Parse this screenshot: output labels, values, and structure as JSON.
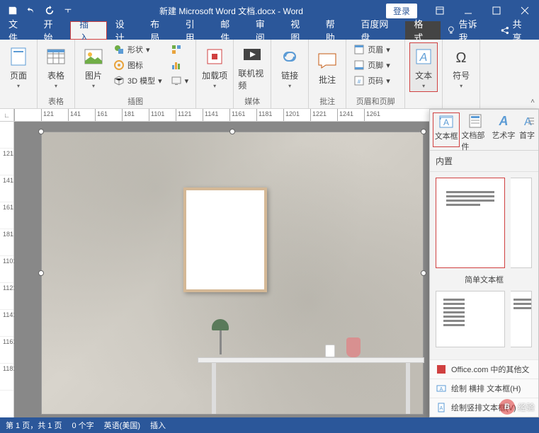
{
  "titlebar": {
    "doc_title": "新建 Microsoft Word 文档.docx - Word",
    "login": "登录"
  },
  "tabs": {
    "file": "文件",
    "home": "开始",
    "insert": "插入",
    "design": "设计",
    "layout": "布局",
    "references": "引用",
    "mailings": "邮件",
    "review": "审阅",
    "view": "视图",
    "help": "帮助",
    "baidu": "百度网盘",
    "format": "格式",
    "tellme": "告诉我",
    "share": "共享"
  },
  "ribbon": {
    "page": "页面",
    "table": "表格",
    "pictures": "图片",
    "shapes": "形状",
    "icons": "图标",
    "model3d": "3D 模型",
    "addins": "加载项",
    "video": "联机视频",
    "links": "链接",
    "comment": "批注",
    "header": "页眉",
    "footer": "页脚",
    "pagenum": "页码",
    "text": "文本",
    "symbols": "符号",
    "grp_table": "表格",
    "grp_illust": "插图",
    "grp_media": "媒体",
    "grp_comment": "批注",
    "grp_hf": "页眉和页脚"
  },
  "dropdown": {
    "textbox": "文本框",
    "parts": "文档部件",
    "wordart": "艺术字",
    "dropcap": "首字",
    "builtin": "内置",
    "thumb1_label": "简单文本框",
    "more_office": "Office.com 中的其他文",
    "draw_h": "绘制 横排 文本框(H)",
    "draw_v": "绘制竖排文本框(V)"
  },
  "ruler": {
    "marks": [
      "",
      "121",
      "141",
      "161",
      "181",
      "1101",
      "1121",
      "1141",
      "1161",
      "1181",
      "1201",
      "1221",
      "1241",
      "1261"
    ]
  },
  "ruler_v": {
    "marks": [
      "",
      "121",
      "141",
      "161",
      "181",
      "1101",
      "1121",
      "1141",
      "1161",
      "1181"
    ]
  },
  "status": {
    "page": "第 1 页，共 1 页",
    "words": "0 个字",
    "lang": "英语(美国)",
    "mode": "插入"
  },
  "watermark": "经验"
}
